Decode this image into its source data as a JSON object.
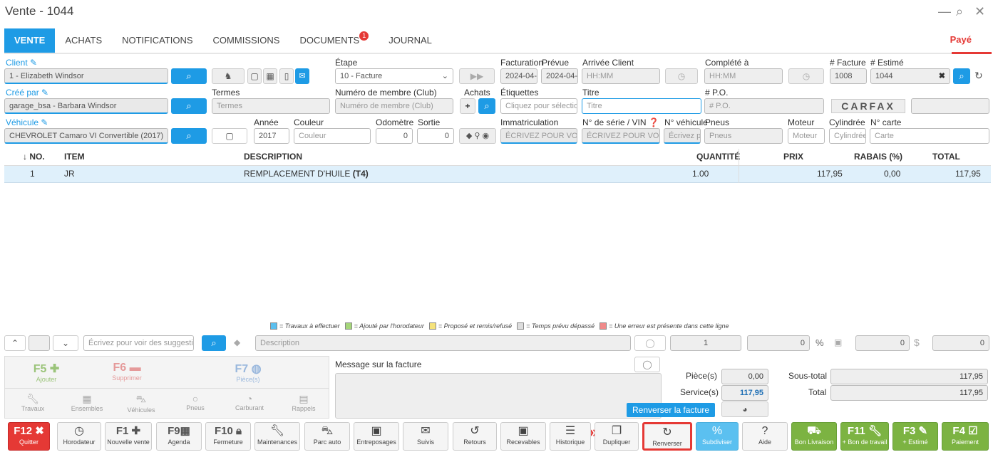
{
  "window": {
    "title": "Vente - 1044",
    "minimize": "—",
    "chat": "⌕",
    "close": "✕"
  },
  "tabs": [
    {
      "label": "VENTE"
    },
    {
      "label": "ACHATS"
    },
    {
      "label": "NOTIFICATIONS"
    },
    {
      "label": "COMMISSIONS"
    },
    {
      "label": "DOCUMENTS",
      "badge": "1"
    },
    {
      "label": "JOURNAL"
    }
  ],
  "status": "Payé",
  "form": {
    "client_label": "Client",
    "client_value": "1 - Elizabeth Windsor",
    "etape_label": "Étape",
    "etape_value": "10 - Facture",
    "facturation_label": "Facturation",
    "facturation_value": "2024-04-",
    "prevue_label": "Prévue",
    "prevue_value": "2024-04-",
    "arrivee_label": "Arrivée Client",
    "arrivee_placeholder": "HH:MM",
    "complete_label": "Complété à",
    "complete_placeholder": "HH:MM",
    "facture_label": "# Facture",
    "facture_value": "1008",
    "estime_label": "# Estimé",
    "estime_value": "1044",
    "cree_label": "Créé par",
    "cree_value": "garage_bsa - Barbara Windsor",
    "termes_label": "Termes",
    "termes_placeholder": "Termes",
    "membre_label": "Numéro de membre (Club)",
    "membre_placeholder": "Numéro de membre (Club)",
    "achats_label": "Achats",
    "etiquettes_label": "Étiquettes",
    "etiquettes_placeholder": "Cliquez pour sélection",
    "titre_label": "Titre",
    "titre_placeholder": "Titre",
    "po_label": "# P.O.",
    "po_placeholder": "# P.O.",
    "carfax": "CARFAX",
    "vehicule_label": "Véhicule",
    "vehicule_value": "CHEVROLET Camaro VI Convertible (2017)",
    "annee_label": "Année",
    "annee_value": "2017",
    "couleur_label": "Couleur",
    "couleur_placeholder": "Couleur",
    "odometre_label": "Odomètre",
    "odometre_value": "0",
    "sortie_label": "Sortie",
    "sortie_value": "0",
    "immat_label": "Immatriculation",
    "immat_placeholder": "ÉCRIVEZ POUR VOIR",
    "vin_label": "N° de série / VIN",
    "vin_placeholder": "ÉCRIVEZ POUR VOIR",
    "nveh_label": "N° véhicule",
    "nveh_placeholder": "Écrivez p",
    "pneus_label": "Pneus",
    "pneus_placeholder": "Pneus",
    "moteur_label": "Moteur",
    "moteur_placeholder": "Moteur",
    "cylindree_label": "Cylindrée",
    "cylindree_placeholder": "Cylindrée",
    "ncarte_label": "N° carte",
    "ncarte_placeholder": "Carte"
  },
  "table": {
    "headers": {
      "no": "↓ NO.",
      "item": "ITEM",
      "description": "DESCRIPTION",
      "quantite": "QUANTITÉ",
      "prix": "PRIX",
      "rabais": "RABAIS (%)",
      "total": "TOTAL"
    },
    "rows": [
      {
        "no": "1",
        "item": "JR",
        "description": "REMPLACEMENT D'HUILE",
        "code": "(T4)",
        "quantite": "1.00",
        "prix": "117,95",
        "rabais": "0,00",
        "total": "117,95"
      }
    ]
  },
  "legend": [
    {
      "text": "= Travaux à effectuer",
      "color": "#5bc0f0"
    },
    {
      "text": "= Ajouté par l'horodateur",
      "color": "#a5d67a"
    },
    {
      "text": "= Proposé et remis/refusé",
      "color": "#f5e27a"
    },
    {
      "text": "= Temps prévu dépassé",
      "color": "#dddddd"
    },
    {
      "text": "= Une erreur est présente dans cette ligne",
      "color": "#f08a8a"
    }
  ],
  "entry": {
    "suggest_placeholder": "Écrivez pour voir des suggestio",
    "description_placeholder": "Description",
    "qty": "1",
    "v1": "0",
    "v2": "0",
    "v3": "0"
  },
  "fkeys": {
    "f5": "F5",
    "f5_sub": "Ajouter",
    "f6": "F6",
    "f6_sub": "Supprimer",
    "f7": "F7",
    "f7_sub": "Pièce(s)"
  },
  "categories": [
    "Travaux",
    "Ensembles",
    "Véhicules",
    "Pneus",
    "Carburant",
    "Rappels"
  ],
  "message_label": "Message sur la facture",
  "totals": {
    "pieces_label": "Pièce(s)",
    "pieces_value": "0,00",
    "service_label": "Service(s)",
    "service_value": "117,95",
    "soustotal_label": "Sous-total",
    "soustotal_value": "117,95",
    "total_label": "Total",
    "total_value": "117,95"
  },
  "tooltip": "Renverser la facture",
  "bottom_buttons": {
    "quitter": {
      "key": "F12",
      "label": "Quitter"
    },
    "horodateur": {
      "label": "Horodateur"
    },
    "nouvelle": {
      "key": "F1",
      "label": "Nouvelle vente"
    },
    "agenda": {
      "key": "F9",
      "label": "Agenda"
    },
    "fermeture": {
      "key": "F10",
      "label": "Fermeture"
    },
    "maintenances": {
      "label": "Maintenances"
    },
    "parcauto": {
      "label": "Parc auto"
    },
    "entreposages": {
      "label": "Entreposages"
    },
    "suivis": {
      "label": "Suivis"
    },
    "retours": {
      "label": "Retours"
    },
    "recevables": {
      "label": "Recevables"
    },
    "historique": {
      "label": "Historique"
    },
    "dupliquer": {
      "label": "Dupliquer"
    },
    "renverser": {
      "label": "Renverser"
    },
    "subdiviser": {
      "label": "Subdiviser"
    },
    "aide": {
      "label": "Aide"
    },
    "livraison": {
      "label": "Bon Livraison"
    },
    "bontravail": {
      "key": "F11",
      "label": "+ Bon de travail"
    },
    "estime": {
      "key": "F3",
      "label": "+ Estimé"
    },
    "paiement": {
      "key": "F4",
      "label": "Paiement"
    }
  }
}
